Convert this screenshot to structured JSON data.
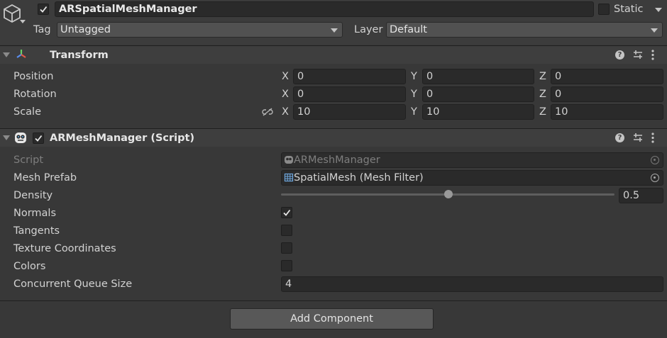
{
  "object": {
    "name": "ARSpatialMeshManager",
    "active": true,
    "static_label": "Static",
    "is_static": false,
    "tag_label": "Tag",
    "tag_value": "Untagged",
    "layer_label": "Layer",
    "layer_value": "Default"
  },
  "transform": {
    "title": "Transform",
    "rows": [
      {
        "label": "Position",
        "x": "0",
        "y": "0",
        "z": "0"
      },
      {
        "label": "Rotation",
        "x": "0",
        "y": "0",
        "z": "0"
      },
      {
        "label": "Scale",
        "x": "10",
        "y": "10",
        "z": "10"
      }
    ],
    "axis_x": "X",
    "axis_y": "Y",
    "axis_z": "Z"
  },
  "mesh_manager": {
    "title": "ARMeshManager (Script)",
    "enabled": true,
    "script_label": "Script",
    "script_value": "ARMeshManager",
    "mesh_prefab_label": "Mesh Prefab",
    "mesh_prefab_value": "SpatialMesh (Mesh Filter)",
    "density_label": "Density",
    "density_value": "0.5",
    "density_fraction": 0.5,
    "normals_label": "Normals",
    "normals": true,
    "tangents_label": "Tangents",
    "tangents": false,
    "texcoords_label": "Texture Coordinates",
    "texcoords": false,
    "colors_label": "Colors",
    "colors": false,
    "queue_label": "Concurrent Queue Size",
    "queue_value": "4"
  },
  "footer": {
    "add_component_label": "Add Component"
  },
  "colors": {
    "panel_bg": "#383838",
    "header_bg": "#3e3e3e",
    "field_bg": "#2a2a2a",
    "text": "#d2d2d2"
  }
}
